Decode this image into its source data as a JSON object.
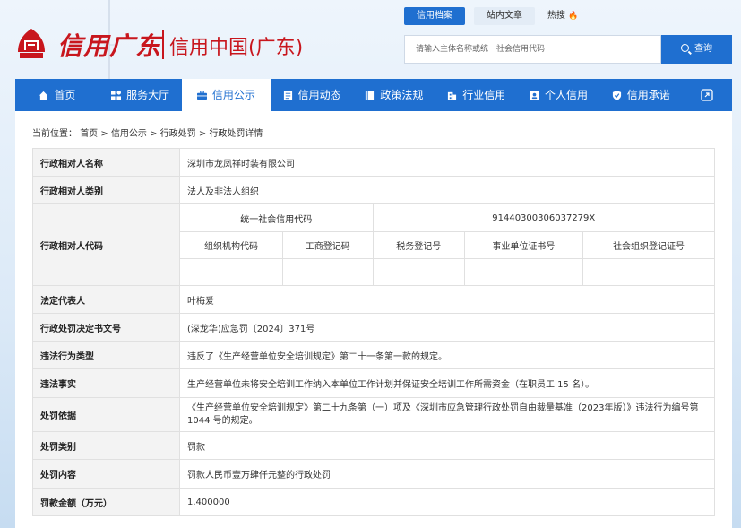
{
  "header": {
    "logo_script": "信用广东",
    "logo_text": "信用中国(广东)",
    "search_tabs": [
      "信用档案",
      "站内文章"
    ],
    "hot_label": "热搜",
    "search_placeholder": "请输入主体名称或统一社会信用代码",
    "search_button": "查询"
  },
  "nav": {
    "items": [
      {
        "label": "首页",
        "icon": "home-icon"
      },
      {
        "label": "服务大厅",
        "icon": "grid-icon"
      },
      {
        "label": "信用公示",
        "icon": "briefcase-icon",
        "active": true
      },
      {
        "label": "信用动态",
        "icon": "document-icon"
      },
      {
        "label": "政策法规",
        "icon": "book-icon"
      },
      {
        "label": "行业信用",
        "icon": "building-icon"
      },
      {
        "label": "个人信用",
        "icon": "person-card-icon"
      },
      {
        "label": "信用承诺",
        "icon": "shield-icon"
      }
    ]
  },
  "breadcrumb": {
    "prefix": "当前位置：",
    "items": [
      "首页",
      "信用公示",
      "行政处罚",
      "行政处罚详情"
    ]
  },
  "detail": {
    "name_label": "行政相对人名称",
    "name_value": "深圳市龙凤祥时装有限公司",
    "category_label": "行政相对人类别",
    "category_value": "法人及非法人组织",
    "code_label": "行政相对人代码",
    "code_uscc_label": "统一社会信用代码",
    "code_uscc_value": "91440300306037279X",
    "code_sub_headers": [
      "组织机构代码",
      "工商登记码",
      "税务登记号",
      "事业单位证书号",
      "社会组织登记证号"
    ],
    "rep_label": "法定代表人",
    "rep_value": "叶梅爱",
    "decision_label": "行政处罚决定书文号",
    "decision_value": "(深龙华)应急罚〔2024〕371号",
    "type_label": "违法行为类型",
    "type_value": "违反了《生产经营单位安全培训规定》第二十一条第一款的规定。",
    "fact_label": "违法事实",
    "fact_value": "生产经营单位未将安全培训工作纳入本单位工作计划并保证安全培训工作所需资金（在职员工 15 名）。",
    "basis_label": "处罚依据",
    "basis_value": "《生产经营单位安全培训规定》第二十九条第（一）项及《深圳市应急管理行政处罚自由裁量基准（2023年版）》违法行为编号第 1044 号的规定。",
    "penalty_type_label": "处罚类别",
    "penalty_type_value": "罚款",
    "penalty_content_label": "处罚内容",
    "penalty_content_value": "罚款人民币壹万肆仟元整的行政处罚",
    "amount_label": "罚款金额（万元）",
    "amount_value": "1.400000"
  }
}
